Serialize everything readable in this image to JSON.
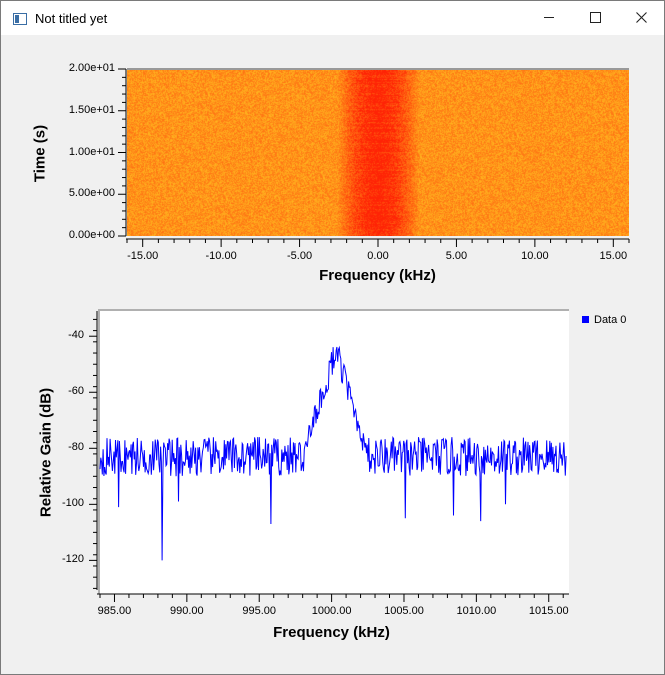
{
  "window": {
    "title": "Not titled yet",
    "icon": "app-window-icon",
    "controls": [
      "minimize-icon",
      "maximize-icon",
      "close-icon"
    ]
  },
  "colors": {
    "window_bg": "#f0f0f0",
    "plot_bg": "#ffffff",
    "trace": "#0000ff",
    "waterfall_low": "#ffd700",
    "waterfall_high": "#ff2000"
  },
  "chart_data": [
    {
      "type": "heatmap",
      "xlabel": "Frequency (kHz)",
      "ylabel": "Time (s)",
      "xlim": [
        -16,
        16
      ],
      "ylim": [
        0,
        20
      ],
      "x_ticks": [
        "-15.00",
        "-10.00",
        "-5.00",
        "0.00",
        "5.00",
        "10.00",
        "15.00"
      ],
      "x_tick_values": [
        -15,
        -10,
        -5,
        0,
        5,
        10,
        15
      ],
      "y_ticks": [
        "0.00e+00",
        "5.00e+00",
        "1.00e+01",
        "1.50e+01",
        "2.00e+01"
      ],
      "y_tick_values": [
        0,
        5,
        10,
        15,
        20
      ],
      "signal_band_khz": [
        -2.6,
        2.6
      ],
      "signal_center_khz": 0
    },
    {
      "type": "line",
      "xlabel": "Frequency (kHz)",
      "ylabel": "Relative Gain (dB)",
      "xlim": [
        984,
        1016.4
      ],
      "ylim": [
        -132,
        -31
      ],
      "x_ticks": [
        "985.00",
        "990.00",
        "995.00",
        "1000.00",
        "1005.00",
        "1010.00",
        "1015.00"
      ],
      "x_tick_values": [
        985,
        990,
        995,
        1000,
        1005,
        1010,
        1015
      ],
      "y_ticks": [
        "-40",
        "-60",
        "-80",
        "-100",
        "-120"
      ],
      "y_tick_values": [
        -40,
        -60,
        -80,
        -100,
        -120
      ],
      "legend": {
        "position": "top-right",
        "entries": [
          "Data 0"
        ]
      },
      "series": [
        {
          "name": "Data 0",
          "x_range": [
            984,
            1016.2
          ],
          "noise_floor_db": -83,
          "peak": {
            "x": 1000.3,
            "y": -45
          },
          "outliers": [
            {
              "x": 985.3,
              "y": -101
            },
            {
              "x": 988.3,
              "y": -120
            },
            {
              "x": 989.4,
              "y": -99
            },
            {
              "x": 995.8,
              "y": -107
            },
            {
              "x": 1005.1,
              "y": -105
            },
            {
              "x": 1008.4,
              "y": -104
            },
            {
              "x": 1010.3,
              "y": -106
            },
            {
              "x": 1012.0,
              "y": -100
            }
          ]
        }
      ]
    }
  ]
}
